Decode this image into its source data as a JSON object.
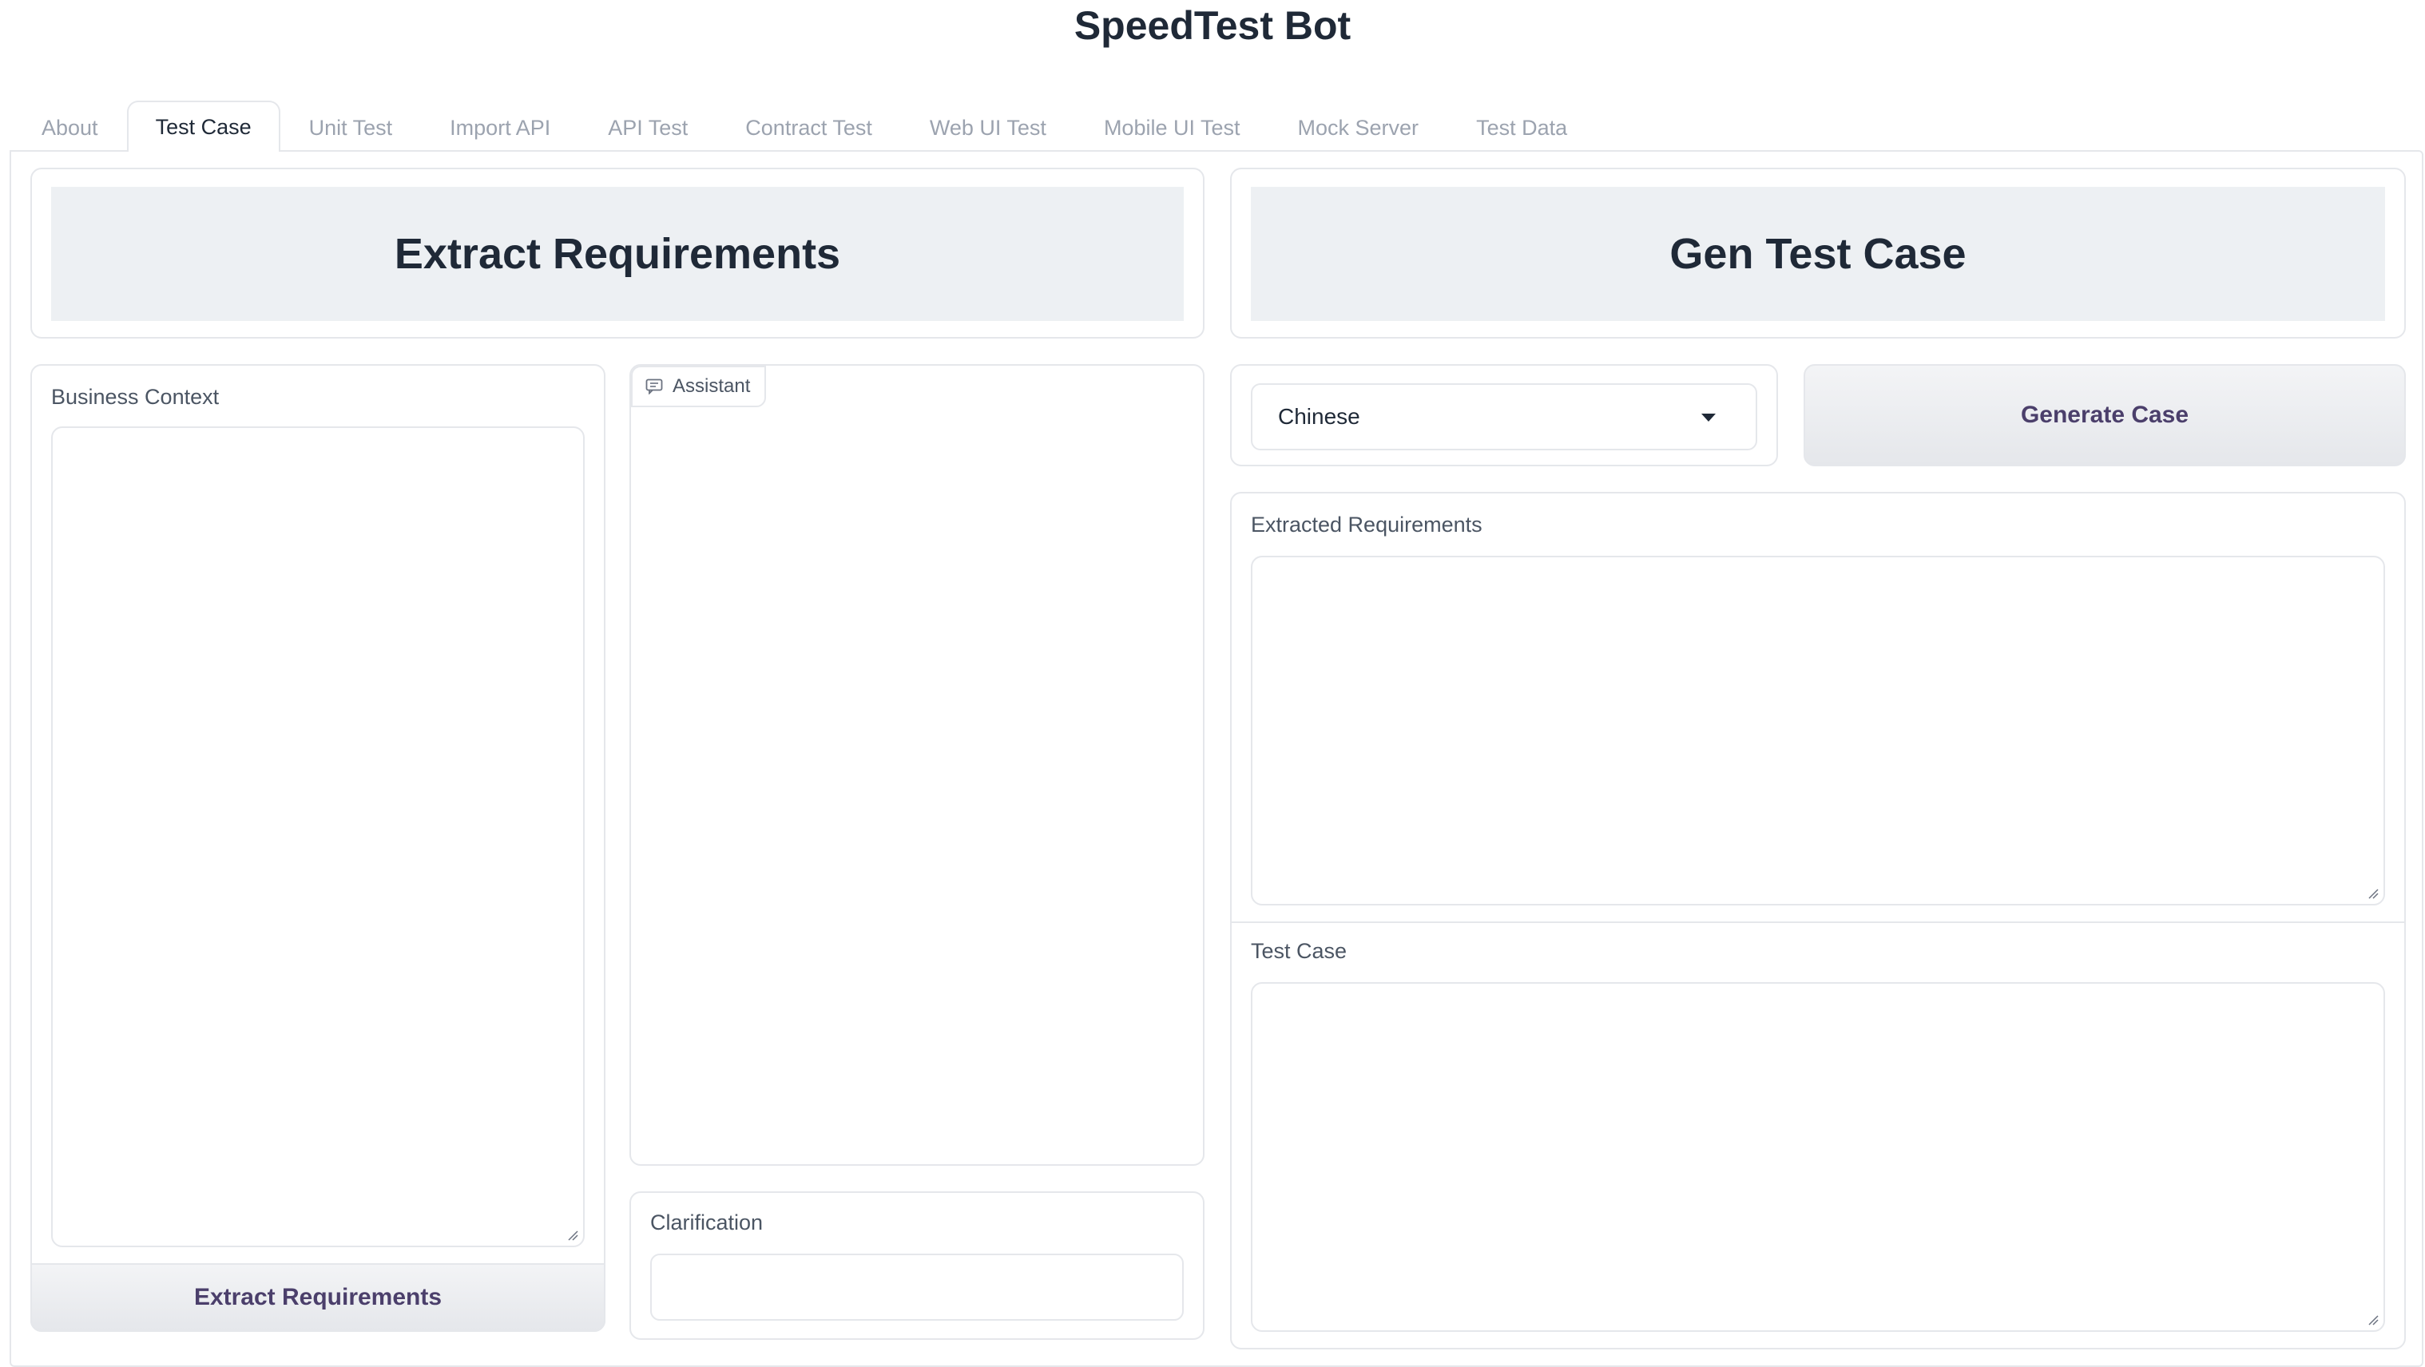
{
  "app": {
    "title": "SpeedTest Bot"
  },
  "tabs": [
    {
      "label": "About"
    },
    {
      "label": "Test Case",
      "active": true
    },
    {
      "label": "Unit Test"
    },
    {
      "label": "Import API"
    },
    {
      "label": "API Test"
    },
    {
      "label": "Contract Test"
    },
    {
      "label": "Web UI Test"
    },
    {
      "label": "Mobile UI Test"
    },
    {
      "label": "Mock Server"
    },
    {
      "label": "Test Data"
    }
  ],
  "left": {
    "header": "Extract Requirements",
    "business_context": {
      "label": "Business Context",
      "value": ""
    },
    "extract_button": "Extract Requirements",
    "chatbot": {
      "label": "Assistant",
      "icon": "chat-icon"
    },
    "clarification": {
      "label": "Clarification",
      "value": ""
    }
  },
  "right": {
    "header": "Gen Test Case",
    "language": {
      "selected": "Chinese"
    },
    "generate_button": "Generate Case",
    "extracted_requirements": {
      "label": "Extracted Requirements",
      "value": ""
    },
    "test_case": {
      "label": "Test Case",
      "value": ""
    }
  },
  "colors": {
    "header_bg": "#edf0f3",
    "border": "#e5e7eb",
    "button_text": "#4b3f6b",
    "tab_inactive": "#9ca3af"
  }
}
